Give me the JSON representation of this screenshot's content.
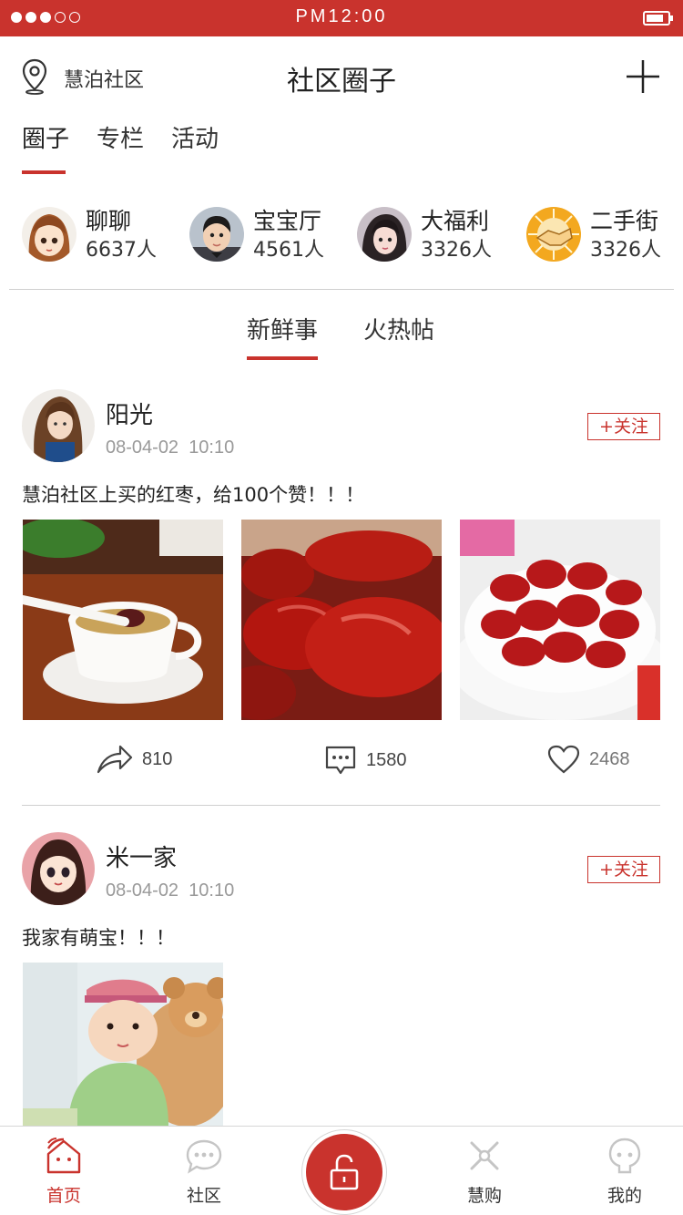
{
  "status_bar": {
    "time": "PM12:00",
    "signal_bars": 3,
    "signal_total": 5,
    "battery_level": 0.8
  },
  "header": {
    "location": "慧泊社区",
    "title": "社区圈子",
    "location_icon": "location-pin-icon",
    "add_icon": "plus-icon"
  },
  "top_tabs": [
    {
      "label": "圈子",
      "active": true
    },
    {
      "label": "专栏",
      "active": false
    },
    {
      "label": "活动",
      "active": false
    }
  ],
  "circles": [
    {
      "name": "聊聊",
      "count": "6637人",
      "avatar": "cartoon-girl-avatar"
    },
    {
      "name": "宝宝厅",
      "count": "4561人",
      "avatar": "baby-avatar"
    },
    {
      "name": "大福利",
      "count": "3326人",
      "avatar": "girl-avatar"
    },
    {
      "name": "二手街",
      "count": "3326人",
      "avatar": "handshake-avatar"
    }
  ],
  "feed_tabs": [
    {
      "label": "新鲜事",
      "active": true
    },
    {
      "label": "火热帖",
      "active": false
    }
  ],
  "posts": [
    {
      "username": "阳光",
      "date": "08-04-02",
      "time": "10:10",
      "follow_label": "+关注",
      "text": "慧泊社区上买的红枣，给100个赞！！！",
      "photos": [
        "red-date-soup-photo",
        "red-dates-closeup-photo",
        "red-dates-bowl-photo"
      ],
      "shares": "810",
      "comments": "1580",
      "likes": "2468"
    },
    {
      "username": "米一家",
      "date": "08-04-02",
      "time": "10:10",
      "follow_label": "+关注",
      "text": "我家有萌宝！！！",
      "photos": [
        "baby-with-teddy-photo"
      ]
    }
  ],
  "tab_bar": {
    "items": [
      {
        "label": "首页",
        "icon": "home-icon",
        "active": true
      },
      {
        "label": "社区",
        "icon": "chat-bubble-icon",
        "active": false
      },
      {
        "label": "慧购",
        "icon": "shop-icon",
        "active": false
      },
      {
        "label": "我的",
        "icon": "profile-icon",
        "active": false
      }
    ],
    "center_icon": "unlock-icon"
  },
  "colors": {
    "accent": "#c9332d",
    "divider": "#cfcfcf",
    "muted_text": "#999999"
  }
}
